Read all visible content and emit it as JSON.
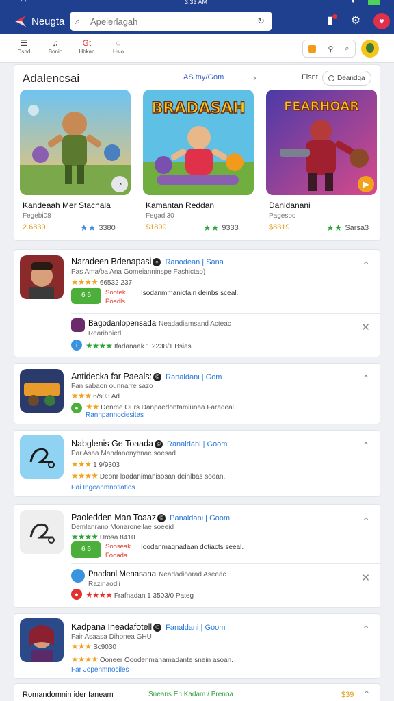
{
  "status": {
    "time": "3:33 AM"
  },
  "app": {
    "title": "Neugta"
  },
  "search": {
    "placeholder": "Apelerlagah"
  },
  "subnav": {
    "items": [
      "Dsnd",
      "Bonio",
      "Hbkan",
      "Hsio"
    ]
  },
  "featured": {
    "heading": "Adalencsai",
    "mid_link": "AS tny/Gom",
    "filter_label": "Fisnt",
    "pill_label": "Deandga",
    "cards": [
      {
        "title": "Kandeaah Mer Stachala",
        "sub": "Fegebi08",
        "price": "2.6839",
        "rating": "3380"
      },
      {
        "title": "Kamantan Reddan",
        "sub": "Fegadi30",
        "price": "$1899",
        "rating": "9333"
      },
      {
        "title": "Danldanani",
        "sub": "Pagesoo",
        "price": "$8319",
        "rating": "Sarsa3"
      }
    ],
    "art_titles": [
      "BRADASAH",
      "FEARHOAR"
    ]
  },
  "list": [
    {
      "title": "Naradeen Bdenapasi",
      "tag": "Ranodean | Sana",
      "line1": "Pas Ama/ba Ana Gomeianninspe Fashictao)",
      "line2": "66532 237",
      "btn": "6 6",
      "red": [
        "Sootek",
        "Poadls"
      ],
      "desc": "Isodanmmanictain deinbs sceal.",
      "sub": {
        "title": "Bagodanlopensada",
        "gray": "Neadadiamsand Acteac",
        "line": "Rearihoied",
        "stars": "Ifadanaak 1 2238/1 Bsias"
      }
    },
    {
      "title": "Antidecka far Paeals:",
      "tag": "Ranaldani | Gom",
      "line1": "Fan sabaon ounnarre sazo",
      "line2": "6/s03 Ad",
      "desc": "Denme Ours Danpaedontamiunaa Faradeal.",
      "link": "Rannpannociesitas"
    },
    {
      "title": "Nabglenis Ge Toaada",
      "tag": "Ranaldani | Goom",
      "line1": "Par Asaa Mandanonyhnae soesad",
      "line2": "1 9/9303",
      "desc": "Deonr loadanimanisosan deinlbas soean.",
      "link": "Pai Ingeanmnotiatios"
    },
    {
      "title": "Paoledden Man Toaaz",
      "tag": "Panaldani | Goom",
      "line1": "Demlanrano Monaronellae soeeid",
      "line2": "Hrosa 8410",
      "btn": "6 6",
      "red": [
        "Sooseak",
        "Fooada"
      ],
      "desc": "Ioodanmagnadaan dotiacts seeal.",
      "sub": {
        "title": "Pnadanl Menasana",
        "gray": "Neadadioarad Aseeac",
        "line": "Razinaodii",
        "stars": "Frafnadan 1 3503/0 Pateg"
      }
    },
    {
      "title": "Kadpana Ineadafotell",
      "tag": "Fanaldani | Goom",
      "line1": "Fair Asaasa Dihonea GHU",
      "line2": "Sc9030",
      "desc": "Ooneer Ooodenmanamadante snein asoan.",
      "link": "Far Jopenmnociles"
    }
  ],
  "bottom": {
    "left": "Romandomnin ider Ianeam",
    "mid": "Sneans En Kadam / Prenoa",
    "price": "$39"
  }
}
